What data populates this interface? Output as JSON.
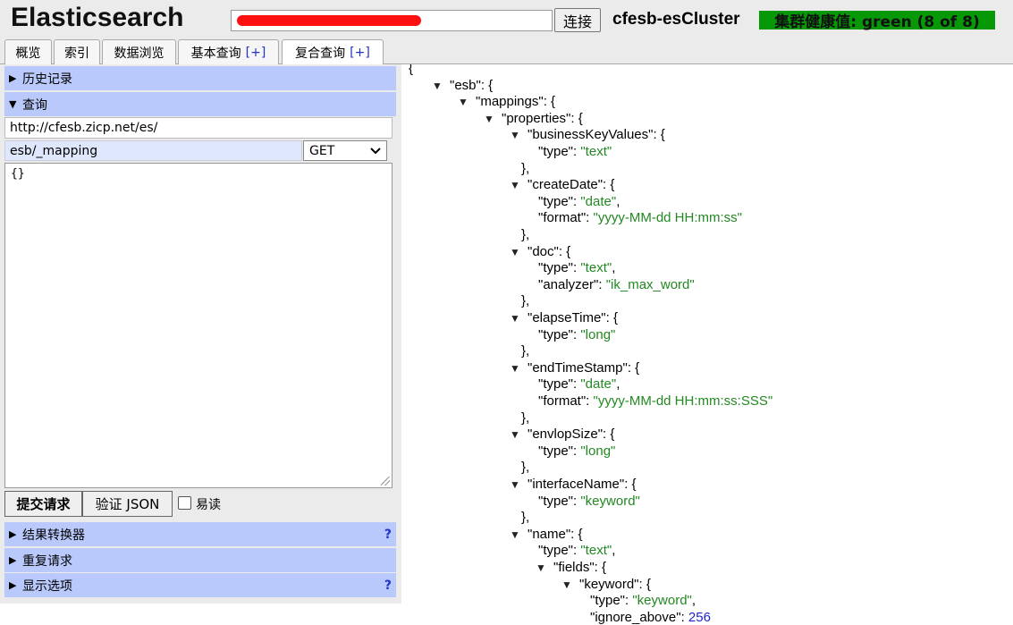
{
  "header": {
    "app_title": "Elasticsearch",
    "connect_label": "连接",
    "cluster_name": "cfesb-esCluster",
    "health": "集群健康值: green (8 of 8)"
  },
  "tabs": [
    {
      "label": "概览",
      "plus": ""
    },
    {
      "label": "索引",
      "plus": ""
    },
    {
      "label": "数据浏览",
      "plus": ""
    },
    {
      "label": "基本查询",
      "plus": "[+]"
    },
    {
      "label": "复合查询",
      "plus": "[+]"
    }
  ],
  "left": {
    "history_label": "历史记录",
    "query_label": "查询",
    "base_url": "http://cfesb.zicp.net/es/",
    "path": "esb/_mapping",
    "method": "GET",
    "body": "{}",
    "submit_label": "提交请求",
    "validate_label": "验证 JSON",
    "pretty_label": "易读",
    "transformer_label": "结果转换器",
    "repeat_label": "重复请求",
    "display_label": "显示选项",
    "help": "?"
  },
  "json_lines": [
    {
      "i": 0,
      "tog": false,
      "key": "",
      "val": "",
      "vt": "",
      "tail": "{"
    },
    {
      "i": 1,
      "tog": true,
      "key": "\"esb\"",
      "val": "",
      "vt": "",
      "tail": ": {"
    },
    {
      "i": 2,
      "tog": true,
      "key": "\"mappings\"",
      "val": "",
      "vt": "",
      "tail": ": {"
    },
    {
      "i": 3,
      "tog": true,
      "key": "\"properties\"",
      "val": "",
      "vt": "",
      "tail": ": {"
    },
    {
      "i": 4,
      "tog": true,
      "key": "\"businessKeyValues\"",
      "val": "",
      "vt": "",
      "tail": ": {"
    },
    {
      "i": 5,
      "tog": false,
      "key": "\"type\"",
      "val": "\"text\"",
      "vt": "s",
      "tail": ""
    },
    {
      "i": 4,
      "tog": false,
      "key": "",
      "val": "",
      "vt": "",
      "tail": "},",
      "close": true
    },
    {
      "i": 4,
      "tog": true,
      "key": "\"createDate\"",
      "val": "",
      "vt": "",
      "tail": ": {"
    },
    {
      "i": 5,
      "tog": false,
      "key": "\"type\"",
      "val": "\"date\"",
      "vt": "s",
      "tail": ","
    },
    {
      "i": 5,
      "tog": false,
      "key": "\"format\"",
      "val": "\"yyyy-MM-dd HH:mm:ss\"",
      "vt": "s",
      "tail": ""
    },
    {
      "i": 4,
      "tog": false,
      "key": "",
      "val": "",
      "vt": "",
      "tail": "},",
      "close": true
    },
    {
      "i": 4,
      "tog": true,
      "key": "\"doc\"",
      "val": "",
      "vt": "",
      "tail": ": {"
    },
    {
      "i": 5,
      "tog": false,
      "key": "\"type\"",
      "val": "\"text\"",
      "vt": "s",
      "tail": ","
    },
    {
      "i": 5,
      "tog": false,
      "key": "\"analyzer\"",
      "val": "\"ik_max_word\"",
      "vt": "s",
      "tail": ""
    },
    {
      "i": 4,
      "tog": false,
      "key": "",
      "val": "",
      "vt": "",
      "tail": "},",
      "close": true
    },
    {
      "i": 4,
      "tog": true,
      "key": "\"elapseTime\"",
      "val": "",
      "vt": "",
      "tail": ": {"
    },
    {
      "i": 5,
      "tog": false,
      "key": "\"type\"",
      "val": "\"long\"",
      "vt": "s",
      "tail": ""
    },
    {
      "i": 4,
      "tog": false,
      "key": "",
      "val": "",
      "vt": "",
      "tail": "},",
      "close": true
    },
    {
      "i": 4,
      "tog": true,
      "key": "\"endTimeStamp\"",
      "val": "",
      "vt": "",
      "tail": ": {"
    },
    {
      "i": 5,
      "tog": false,
      "key": "\"type\"",
      "val": "\"date\"",
      "vt": "s",
      "tail": ","
    },
    {
      "i": 5,
      "tog": false,
      "key": "\"format\"",
      "val": "\"yyyy-MM-dd HH:mm:ss:SSS\"",
      "vt": "s",
      "tail": ""
    },
    {
      "i": 4,
      "tog": false,
      "key": "",
      "val": "",
      "vt": "",
      "tail": "},",
      "close": true
    },
    {
      "i": 4,
      "tog": true,
      "key": "\"envlopSize\"",
      "val": "",
      "vt": "",
      "tail": ": {"
    },
    {
      "i": 5,
      "tog": false,
      "key": "\"type\"",
      "val": "\"long\"",
      "vt": "s",
      "tail": ""
    },
    {
      "i": 4,
      "tog": false,
      "key": "",
      "val": "",
      "vt": "",
      "tail": "},",
      "close": true
    },
    {
      "i": 4,
      "tog": true,
      "key": "\"interfaceName\"",
      "val": "",
      "vt": "",
      "tail": ": {"
    },
    {
      "i": 5,
      "tog": false,
      "key": "\"type\"",
      "val": "\"keyword\"",
      "vt": "s",
      "tail": ""
    },
    {
      "i": 4,
      "tog": false,
      "key": "",
      "val": "",
      "vt": "",
      "tail": "},",
      "close": true
    },
    {
      "i": 4,
      "tog": true,
      "key": "\"name\"",
      "val": "",
      "vt": "",
      "tail": ": {"
    },
    {
      "i": 5,
      "tog": false,
      "key": "\"type\"",
      "val": "\"text\"",
      "vt": "s",
      "tail": ","
    },
    {
      "i": 5,
      "tog": true,
      "key": "\"fields\"",
      "val": "",
      "vt": "",
      "tail": ": {"
    },
    {
      "i": 6,
      "tog": true,
      "key": "\"keyword\"",
      "val": "",
      "vt": "",
      "tail": ": {"
    },
    {
      "i": 7,
      "tog": false,
      "key": "\"type\"",
      "val": "\"keyword\"",
      "vt": "s",
      "tail": ","
    },
    {
      "i": 7,
      "tog": false,
      "key": "\"ignore_above\"",
      "val": "256",
      "vt": "n",
      "tail": ""
    }
  ]
}
